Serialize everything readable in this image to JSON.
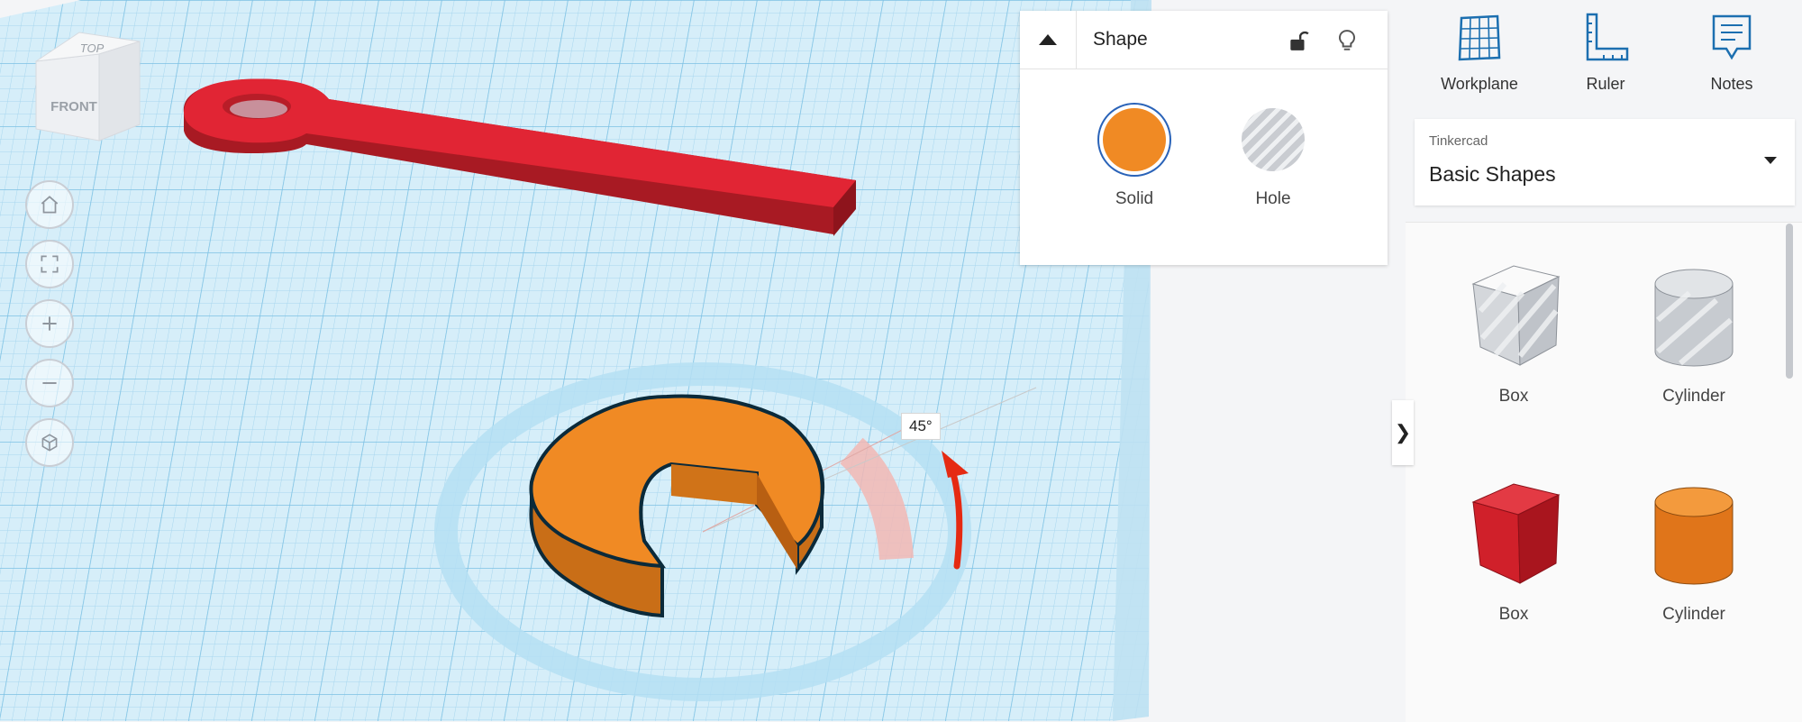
{
  "viewcube": {
    "top_label": "TOP",
    "front_label": "FRONT"
  },
  "view_controls": [
    {
      "name": "home-view-button",
      "icon": "home-icon"
    },
    {
      "name": "fit-view-button",
      "icon": "fit-all-icon"
    },
    {
      "name": "zoom-in-button",
      "icon": "plus-icon"
    },
    {
      "name": "zoom-out-button",
      "icon": "minus-icon"
    },
    {
      "name": "ortho-view-button",
      "icon": "cube-icon"
    }
  ],
  "rotation": {
    "angle_label": "45°"
  },
  "shape_panel": {
    "title": "Shape",
    "solid_label": "Solid",
    "hole_label": "Hole",
    "solid_color": "#f08a24"
  },
  "toolbar": {
    "workplane_label": "Workplane",
    "ruler_label": "Ruler",
    "notes_label": "Notes"
  },
  "library": {
    "source": "Tinkercad",
    "name": "Basic Shapes",
    "shapes": [
      {
        "label": "Box",
        "style": "hole"
      },
      {
        "label": "Cylinder",
        "style": "hole"
      },
      {
        "label": "Box",
        "style": "solid",
        "color": "#d0202a"
      },
      {
        "label": "Cylinder",
        "style": "solid",
        "color": "#ef8421"
      }
    ]
  },
  "colors": {
    "accent": "#1c82c7",
    "wrench_red": "#e12534",
    "part_orange": "#f08a24",
    "grid_blue": "#c9e7f5"
  }
}
